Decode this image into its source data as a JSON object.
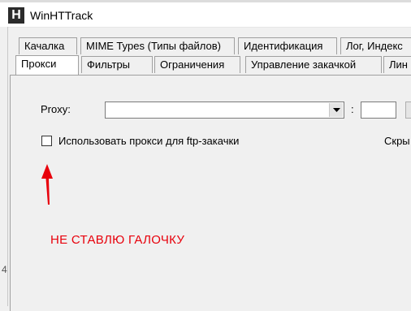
{
  "window": {
    "title": "WinHTTrack",
    "icon_letter": "H"
  },
  "tabs_row1": [
    {
      "label": "Качалка"
    },
    {
      "label": "MIME Types (Типы файлов)"
    },
    {
      "label": "Идентификация"
    },
    {
      "label": "Лог, Индекс"
    }
  ],
  "tabs_row2": [
    {
      "label": "Прокси",
      "active": true
    },
    {
      "label": "Фильтры"
    },
    {
      "label": "Ограничения"
    },
    {
      "label": "Управление закачкой"
    },
    {
      "label": "Лин"
    }
  ],
  "proxy": {
    "label": "Proxy:",
    "value": "",
    "port_separator": ":",
    "port_value": ""
  },
  "ftp_checkbox": {
    "label": "Использовать прокси для ftp-закачки",
    "checked": false
  },
  "hide_label": "Скры",
  "annotation": {
    "text": "НЕ СТАВЛЮ ГАЛОЧКУ",
    "color": "#e8000b"
  }
}
